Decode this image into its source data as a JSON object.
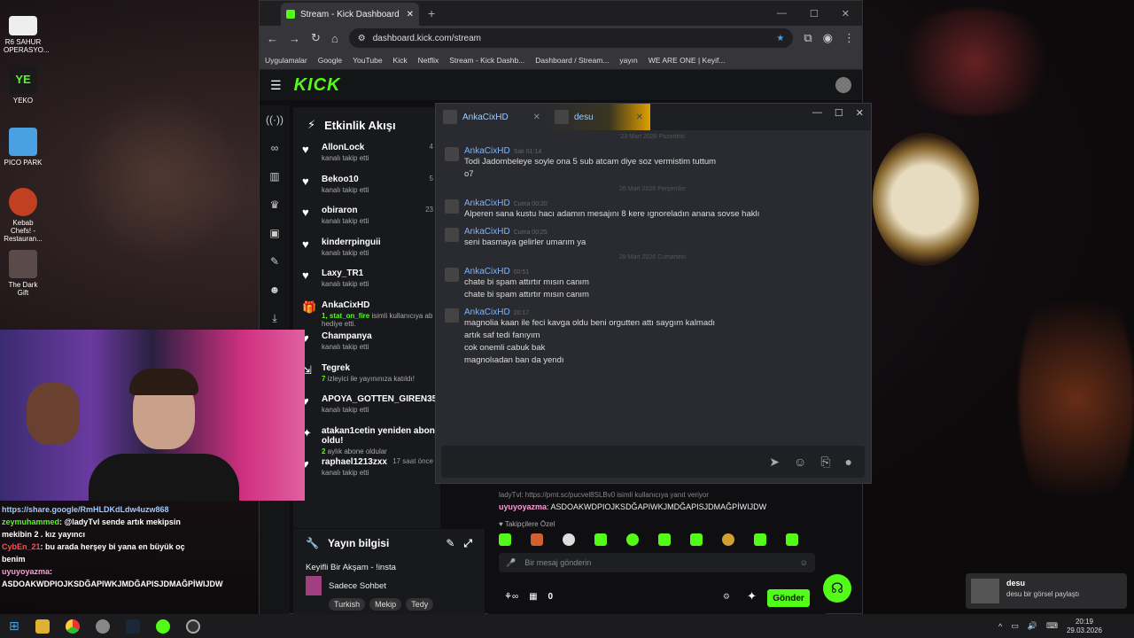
{
  "desktop_icons": [
    {
      "label": "R6 SAHUR OPERASYO..."
    },
    {
      "label": "YEKO"
    },
    {
      "label": "PICO PARK"
    },
    {
      "label": "Kebab Chefs! - Restauran..."
    },
    {
      "label": "The Dark Gift"
    }
  ],
  "browser": {
    "tab_title": "Stream - Kick Dashboard",
    "url": "dashboard.kick.com/stream",
    "bookmarks": [
      "Uygulamalar",
      "Google",
      "YouTube",
      "Kick",
      "Netflix",
      "Stream - Kick Dashb...",
      "Dashboard / Stream...",
      "yayın",
      "WE ARE ONE | Keyif..."
    ]
  },
  "kick": {
    "logo": "KICK",
    "activity_title": "Etkinlik Akışı",
    "activity": [
      {
        "name": "AllonLock",
        "sub": "kanalı takip etti",
        "meta": "4"
      },
      {
        "name": "Bekoo10",
        "sub": "kanalı takip etti",
        "meta": "5"
      },
      {
        "name": "obiraron",
        "sub": "kanalı takip etti",
        "meta": "23"
      },
      {
        "name": "kinderrpinguii",
        "sub": "kanalı takip etti",
        "meta": ""
      },
      {
        "name": "Laxy_TR1",
        "sub": "kanalı takip etti",
        "meta": ""
      },
      {
        "name": "AnkaCixHD",
        "sub_highlight": "1, stat_on_fire",
        "sub": " isimli kullanıcıya ab hediye etti.",
        "meta": ""
      },
      {
        "name": "Champanya",
        "sub": "kanalı takip etti",
        "meta": ""
      },
      {
        "name": "Tegrek",
        "sub_highlight": "7",
        "sub": " izleyici ile yayınınıza katıldı!",
        "meta": ""
      },
      {
        "name": "APOYA_GOTTEN_GIREN35",
        "sub": "kanalı takip etti",
        "meta": ""
      },
      {
        "name": "atakan1cetin yeniden abone oldu!",
        "sub_highlight": "2",
        "sub": " aylık abone oldular",
        "meta": ""
      },
      {
        "name": "raphael1213zxx",
        "sub": "kanalı takip etti",
        "meta": "17 saat önce"
      }
    ],
    "yayin_title": "Yayın bilgisi",
    "stream_title": "Keyifli Bir Akşam - !insta",
    "category": "Sadece Sohbet",
    "tags": [
      "Turkish",
      "Mekip",
      "Tedy"
    ]
  },
  "popup": {
    "tabs": [
      "AnkaCixHD",
      "desu"
    ],
    "messages": [
      {
        "sep": "23 Mart 2026 Pazartesi"
      },
      {
        "name": "AnkaCixHD",
        "time": "Salı 01:14",
        "lines": [
          "Todi Jadombeleye soyle ona 5 sub atcam diye soz vermistim tuttum",
          "o7"
        ]
      },
      {
        "sep": "26 Mart 2026 Perşembe"
      },
      {
        "name": "AnkaCixHD",
        "time": "Cuma 00:20",
        "lines": [
          "Alperen sana kustu hacı adamın mesajını 8 kere ıgnoreladın anana sovse haklı"
        ]
      },
      {
        "name": "AnkaCixHD",
        "time": "Cuma 00:25",
        "lines": [
          "seni basmaya gelirler umarım ya"
        ]
      },
      {
        "sep": "28 Mart 2026 Cumartesi"
      },
      {
        "name": "AnkaCixHD",
        "time": "00:51",
        "lines": [
          "chate bi spam attırtır mısın canım",
          "chate bi spam attırtır mısın canım"
        ]
      },
      {
        "name": "AnkaCixHD",
        "time": "20:17",
        "lines": [
          "magnolia kaan ile feci kavga oldu beni orgutten attı saygım kalmadı",
          "artık saf tedi fanıyım",
          "cok onemli cabuk bak",
          "magnolıadan ban da yendı"
        ]
      }
    ]
  },
  "kick_chat": {
    "reply": "ladyTvl: https://prnt.sc/pucvel8SLBv0 isimli kullanıcıya yanıt veriyor",
    "msg_user": "uyuyoyazma",
    "msg_text": "ASDOAKWDPIOJKSDĞAPIWKJMDĞAPISJDMAĞPİWIJDW",
    "followers_only": "Takipçilere Özel",
    "placeholder": "Bir mesaj gönderin",
    "count": "0",
    "send": "Gönder"
  },
  "stream_chat": [
    {
      "user": "",
      "text": "https://share.google/RmHLDKdLdw4uzw868",
      "color": "#9ecbff"
    },
    {
      "user": "zeymuhammed",
      "text": ": @ladyTvl sende artık mekipsin mekibin 2 . kız yayıncı",
      "color": "#53fc18"
    },
    {
      "user": "CybEn_21",
      "text": ": bu arada herşey bi yana en büyük oç benim",
      "color": "#ff5050"
    },
    {
      "user": "uyuyoyazma",
      "text": ": ASDOAKWDPIOJKSDĞAPIWKJMDĞAPISJDMAĞPİWIJDW",
      "color": "#ff9ad8"
    }
  ],
  "toast": {
    "title": "desu",
    "text": "desu bir görsel paylaştı"
  },
  "clock": {
    "time": "20:19",
    "date": "29.03.2026"
  }
}
